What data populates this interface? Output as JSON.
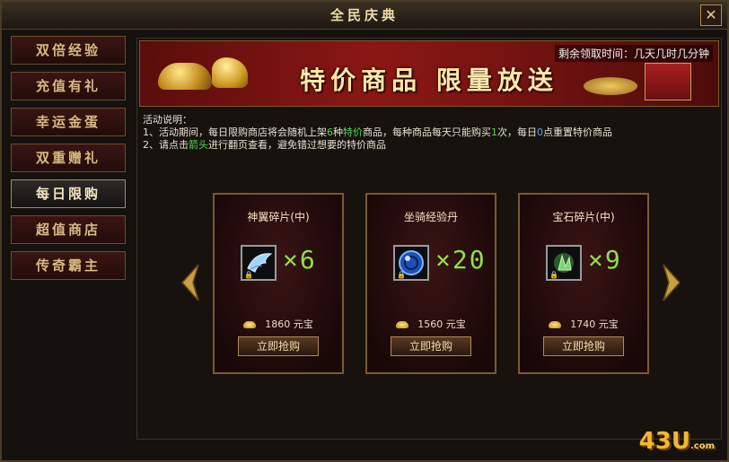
{
  "window": {
    "title": "全民庆典",
    "close_label": "✕"
  },
  "sidebar": {
    "items": [
      {
        "label": "双倍经验"
      },
      {
        "label": "充值有礼"
      },
      {
        "label": "幸运金蛋"
      },
      {
        "label": "双重赠礼"
      },
      {
        "label": "每日限购"
      },
      {
        "label": "超值商店"
      },
      {
        "label": "传奇霸主"
      }
    ],
    "active_index": 4
  },
  "banner": {
    "countdown_label": "剩余领取时间：几天几时几分钟",
    "title": "特价商品   限量放送"
  },
  "description": {
    "heading": "活动说明：",
    "line1_a": "1、活动期间，每日限购商店将会随机上架",
    "line1_b": "6",
    "line1_c": "种",
    "line1_d": "特价",
    "line1_e": "商品，每种商品每天只能购买",
    "line1_f": "1",
    "line1_g": "次，每日",
    "line1_h": "0",
    "line1_i": "点重置特价商品",
    "line2_a": "2、请点击",
    "line2_b": "箭头",
    "line2_c": "进行翻页查看，避免错过想要的特价商品"
  },
  "products": [
    {
      "name": "神翼碎片(中)",
      "qty": "×6",
      "price": "1860",
      "currency": "元宝",
      "buy_label": "立即抢购",
      "icon": "wing-icon"
    },
    {
      "name": "坐骑经验丹",
      "qty": "×20",
      "price": "1560",
      "currency": "元宝",
      "buy_label": "立即抢购",
      "icon": "blue-orb-icon"
    },
    {
      "name": "宝石碎片(中)",
      "qty": "×9",
      "price": "1740",
      "currency": "元宝",
      "buy_label": "立即抢购",
      "icon": "green-gem-icon"
    }
  ],
  "footer": {
    "logo": "43U",
    "logo_suffix": ".com"
  },
  "colors": {
    "accent_gold": "#f0dca8",
    "qty_green": "#8fe04a",
    "banner_red": "#8a1714"
  }
}
